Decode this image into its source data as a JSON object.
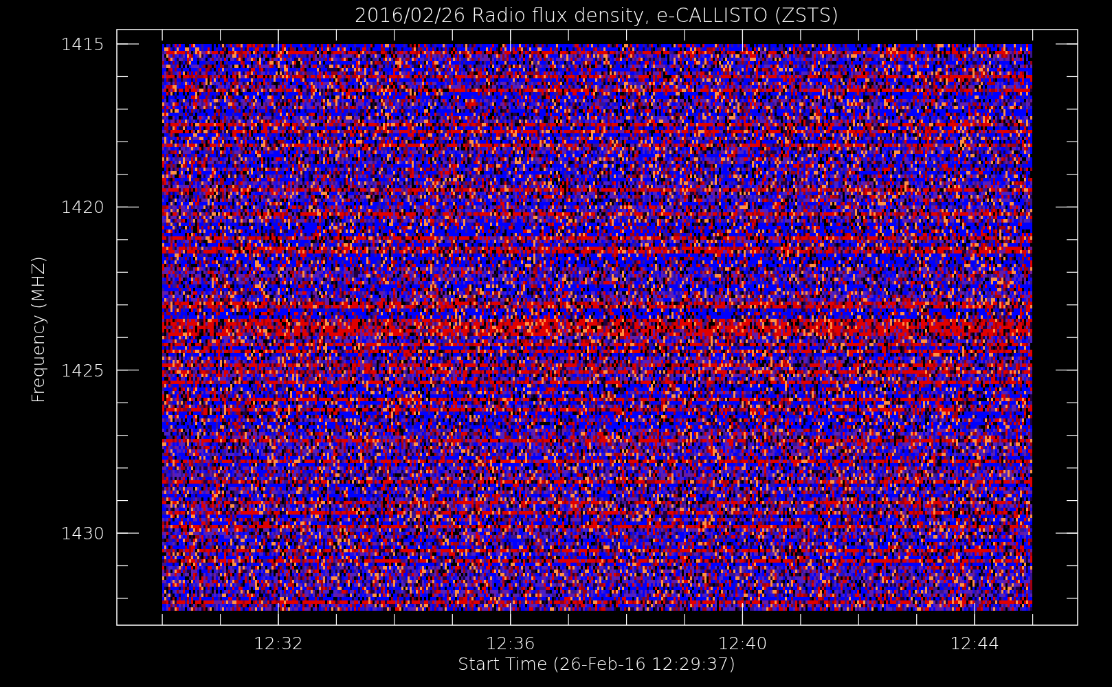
{
  "plot": {
    "title": "2016/02/26  Radio flux density, e-CALLISTO (ZSTS)",
    "y_axis": {
      "label": "Frequency (MHZ)",
      "ticks": [
        "1415",
        "1420",
        "1425",
        "1430"
      ]
    },
    "x_axis": {
      "label": "Start Time (26-Feb-16 12:29:37)",
      "ticks": [
        "12:32",
        "12:36",
        "12:40",
        "12:44"
      ]
    }
  }
}
